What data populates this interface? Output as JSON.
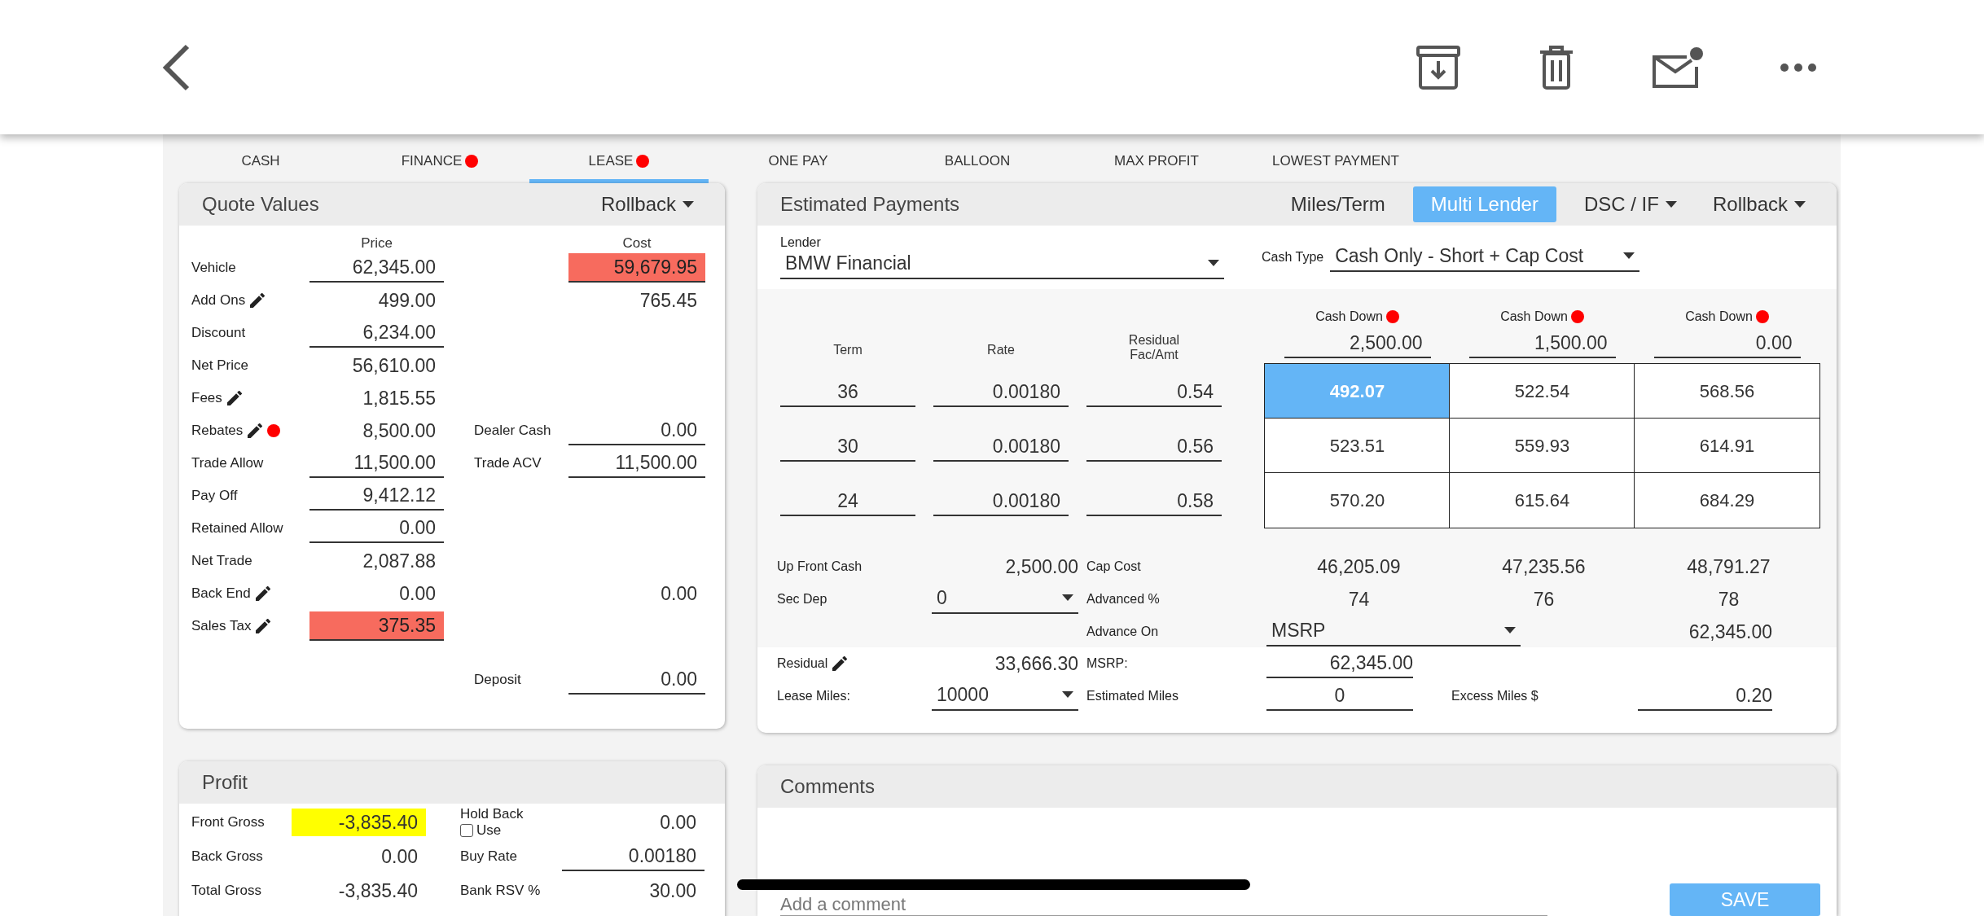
{
  "tabs": [
    {
      "label": "CASH",
      "selected": false,
      "alert": false
    },
    {
      "label": "FINANCE",
      "selected": false,
      "alert": true
    },
    {
      "label": "LEASE",
      "selected": true,
      "alert": true
    },
    {
      "label": "ONE PAY",
      "selected": false,
      "alert": false
    },
    {
      "label": "BALLOON",
      "selected": false,
      "alert": false
    },
    {
      "label": "MAX PROFIT",
      "selected": false,
      "alert": false
    },
    {
      "label": "LOWEST PAYMENT",
      "selected": false,
      "alert": false
    }
  ],
  "quote_values": {
    "title": "Quote Values",
    "menu": "Rollback",
    "price_header": "Price",
    "cost_header": "Cost",
    "rows": [
      {
        "label": "Vehicle",
        "edit": false,
        "alert": false,
        "price": {
          "value": "62,345.00",
          "kind": "field"
        },
        "cost": {
          "value": "59,679.95",
          "kind": "warning"
        }
      },
      {
        "label": "Add Ons",
        "edit": true,
        "alert": false,
        "price": {
          "value": "499.00",
          "kind": "plain"
        },
        "cost": {
          "value": "765.45",
          "kind": "plain"
        }
      },
      {
        "label": "Discount",
        "edit": false,
        "alert": false,
        "price": {
          "value": "6,234.00",
          "kind": "field"
        }
      },
      {
        "label": "Net Price",
        "edit": false,
        "alert": false,
        "price": {
          "value": "56,610.00",
          "kind": "plain"
        }
      },
      {
        "label": "Fees",
        "edit": true,
        "alert": false,
        "price": {
          "value": "1,815.55",
          "kind": "plain"
        }
      },
      {
        "label": "Rebates",
        "edit": true,
        "alert": true,
        "price": {
          "value": "8,500.00",
          "kind": "plain"
        },
        "side_label": "Dealer Cash",
        "cost": {
          "value": "0.00",
          "kind": "field"
        }
      },
      {
        "label": "Trade Allow",
        "edit": false,
        "alert": false,
        "price": {
          "value": "11,500.00",
          "kind": "field"
        },
        "side_label": "Trade ACV",
        "cost": {
          "value": "11,500.00",
          "kind": "field"
        }
      },
      {
        "label": "Pay Off",
        "edit": false,
        "alert": false,
        "price": {
          "value": "9,412.12",
          "kind": "field"
        }
      },
      {
        "label": "Retained Allow",
        "edit": false,
        "alert": false,
        "price": {
          "value": "0.00",
          "kind": "field"
        }
      },
      {
        "label": "Net Trade",
        "edit": false,
        "alert": false,
        "price": {
          "value": "2,087.88",
          "kind": "plain"
        }
      },
      {
        "label": "Back End",
        "edit": true,
        "alert": false,
        "price": {
          "value": "0.00",
          "kind": "plain"
        },
        "cost": {
          "value": "0.00",
          "kind": "plain"
        }
      },
      {
        "label": "Sales Tax",
        "edit": true,
        "alert": false,
        "price": {
          "value": "375.35",
          "kind": "warning"
        }
      },
      {
        "edit": false,
        "alert": false,
        "side_label": "Deposit",
        "cost": {
          "value": "0.00",
          "kind": "field"
        }
      }
    ]
  },
  "profit": {
    "title": "Profit",
    "rows": [
      {
        "label": "Front Gross",
        "value": {
          "value": "-3,835.40",
          "kind": "highlight"
        },
        "side_label": "Hold Back",
        "checkbox": {
          "label": "Use",
          "checked": false
        },
        "side_value": {
          "value": "0.00",
          "kind": "plain"
        }
      },
      {
        "label": "Back Gross",
        "value": {
          "value": "0.00",
          "kind": "plain"
        },
        "side_label": "Buy Rate",
        "side_value": {
          "value": "0.00180",
          "kind": "field"
        }
      },
      {
        "label": "Total Gross",
        "value": {
          "value": "-3,835.40",
          "kind": "plain"
        },
        "side_label": "Bank RSV %",
        "side_value": {
          "value": "30.00",
          "kind": "plain"
        }
      }
    ]
  },
  "payments": {
    "title": "Estimated Payments",
    "buttons": [
      {
        "label": "Miles/Term",
        "selected": false,
        "dropdown": false
      },
      {
        "label": "Multi Lender",
        "selected": true,
        "dropdown": false
      },
      {
        "label": "DSC / IF",
        "selected": false,
        "dropdown": true
      },
      {
        "label": "Rollback",
        "selected": false,
        "dropdown": true
      }
    ],
    "lender": {
      "label": "Lender",
      "value": "BMW Financial"
    },
    "cash_type": {
      "label": "Cash Type",
      "value": "Cash Only - Short + Cap Cost"
    },
    "term_header": "Term",
    "rate_header": "Rate",
    "residual_header": "Residual Fac/Amt",
    "cash_downs": [
      {
        "label": "Cash Down",
        "alert": true,
        "value": "2,500.00"
      },
      {
        "label": "Cash Down",
        "alert": true,
        "value": "1,500.00"
      },
      {
        "label": "Cash Down",
        "alert": true,
        "value": "0.00"
      }
    ],
    "rows": [
      {
        "term": "36",
        "rate": "0.00180",
        "residual": "0.54",
        "payments": [
          {
            "value": "492.07",
            "selected": true
          },
          {
            "value": "522.54",
            "selected": false
          },
          {
            "value": "568.56",
            "selected": false
          }
        ]
      },
      {
        "term": "30",
        "rate": "0.00180",
        "residual": "0.56",
        "payments": [
          {
            "value": "523.51",
            "selected": false
          },
          {
            "value": "559.93",
            "selected": false
          },
          {
            "value": "614.91",
            "selected": false
          }
        ]
      },
      {
        "term": "24",
        "rate": "0.00180",
        "residual": "0.58",
        "payments": [
          {
            "value": "570.20",
            "selected": false
          },
          {
            "value": "615.64",
            "selected": false
          },
          {
            "value": "684.29",
            "selected": false
          }
        ]
      }
    ],
    "up_front_cash": {
      "label": "Up Front Cash",
      "value": "2,500.00"
    },
    "cap_cost": {
      "label": "Cap Cost",
      "values": [
        "46,205.09",
        "47,235.56",
        "48,791.27"
      ]
    },
    "sec_dep": {
      "label": "Sec Dep",
      "value": "0"
    },
    "advanced": {
      "label": "Advanced %",
      "values": [
        "74",
        "76",
        "78"
      ]
    },
    "advance_on": {
      "label": "Advance On",
      "value": "MSRP",
      "amount": "62,345.00"
    },
    "residual": {
      "label": "Residual",
      "value": "33,666.30"
    },
    "msrp": {
      "label": "MSRP:",
      "value": "62,345.00"
    },
    "lease_miles": {
      "label": "Lease Miles:",
      "value": "10000"
    },
    "estimated_miles": {
      "label": "Estimated Miles",
      "value": "0"
    },
    "excess_miles": {
      "label": "Excess Miles $",
      "value": "0.20"
    }
  },
  "comments": {
    "title": "Comments",
    "placeholder": "Add a comment",
    "save": "SAVE"
  }
}
